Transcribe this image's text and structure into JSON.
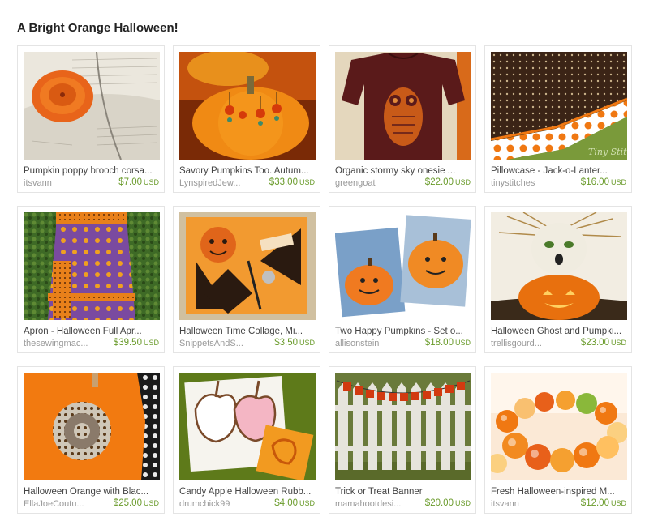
{
  "page": {
    "title": "A Bright Orange Halloween!"
  },
  "items": [
    {
      "name": "Pumpkin poppy brooch corsa...",
      "shop": "itsvann",
      "price": "$7.00",
      "currency": "USD",
      "image_icon": "orange-flower-brooch-photo"
    },
    {
      "name": "Savory Pumpkins Too. Autum...",
      "shop": "LynspiredJew...",
      "price": "$33.00",
      "currency": "USD",
      "image_icon": "pumpkin-earrings-photo"
    },
    {
      "name": "Organic stormy sky onesie ...",
      "shop": "greengoat",
      "price": "$22.00",
      "currency": "USD",
      "image_icon": "owl-onesie-photo"
    },
    {
      "name": "Pillowcase - Jack-o-Lanter...",
      "shop": "tinystitches",
      "price": "$16.00",
      "currency": "USD",
      "image_icon": "pillowcase-photo"
    },
    {
      "name": "Apron - Halloween Full Apr...",
      "shop": "thesewingmac...",
      "price": "$39.50",
      "currency": "USD",
      "image_icon": "apron-photo"
    },
    {
      "name": "Halloween Time Collage, Mi...",
      "shop": "SnippetsAndS...",
      "price": "$3.50",
      "currency": "USD",
      "image_icon": "collage-card-photo"
    },
    {
      "name": "Two Happy Pumpkins - Set o...",
      "shop": "allisonstein",
      "price": "$18.00",
      "currency": "USD",
      "image_icon": "pumpkin-paintings-photo"
    },
    {
      "name": "Halloween Ghost and Pumpki...",
      "shop": "trellisgourd...",
      "price": "$23.00",
      "currency": "USD",
      "image_icon": "ghost-gourd-photo"
    },
    {
      "name": "Halloween Orange with Blac...",
      "shop": "EllaJoeCoutu...",
      "price": "$25.00",
      "currency": "USD",
      "image_icon": "orange-onesie-flower-photo"
    },
    {
      "name": "Candy Apple Halloween Rubb...",
      "shop": "drumchick99",
      "price": "$4.00",
      "currency": "USD",
      "image_icon": "candy-apple-stamp-photo"
    },
    {
      "name": "Trick or Treat Banner",
      "shop": "mamahootdesi...",
      "price": "$20.00",
      "currency": "USD",
      "image_icon": "picket-fence-banner-photo"
    },
    {
      "name": "Fresh Halloween-inspired M...",
      "shop": "itsvann",
      "price": "$12.00",
      "currency": "USD",
      "image_icon": "bead-bracelet-photo"
    }
  ],
  "colors": {
    "price": "#6a9b2b",
    "border": "#e4e4e4",
    "orange": "#f07a12"
  }
}
